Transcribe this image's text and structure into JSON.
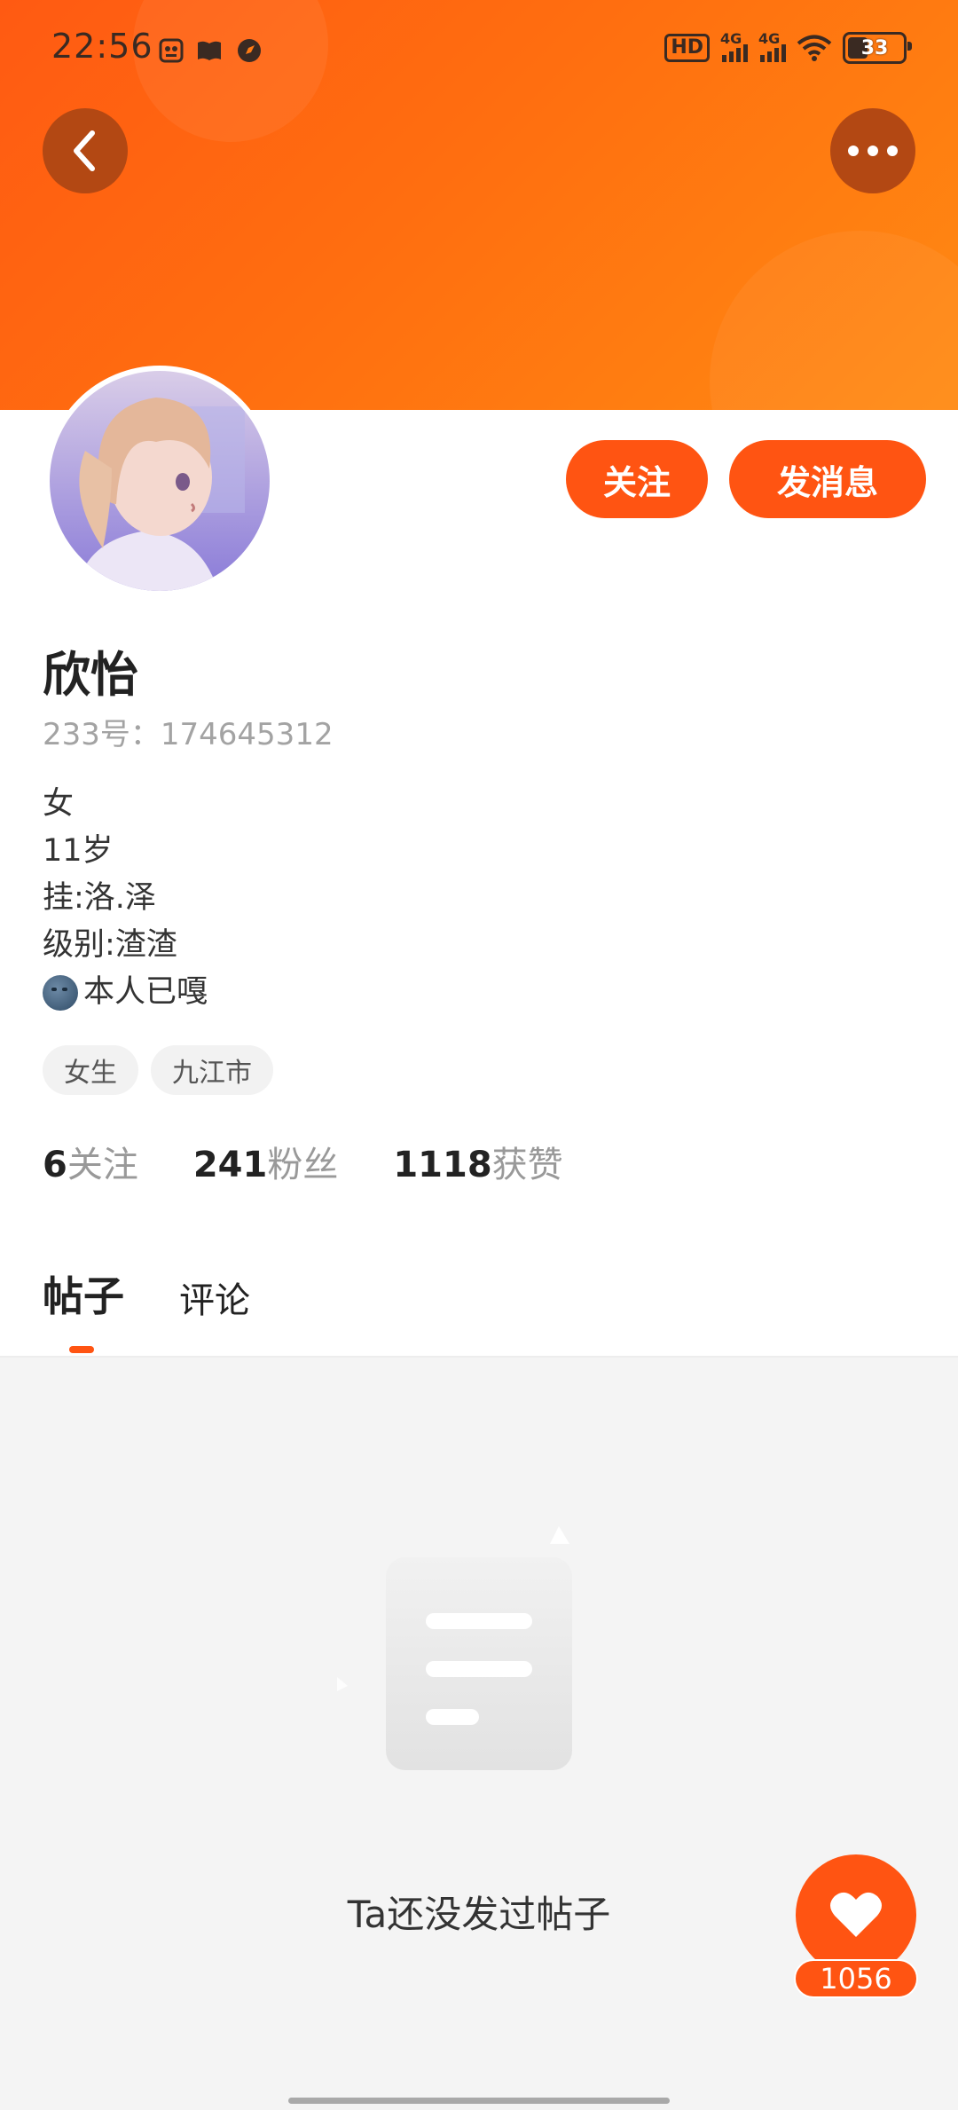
{
  "status_bar": {
    "time": "22:56",
    "hd_label": "HD",
    "network_1": "4G",
    "network_2": "4G",
    "battery": "33"
  },
  "profile": {
    "name": "欣怡",
    "id_line": "233号：174645312",
    "bio": [
      "女",
      "11岁",
      "挂:洛.泽",
      "级别:渣渣",
      "本人已嘎"
    ],
    "tags": [
      "女生",
      "九江市"
    ]
  },
  "actions": {
    "follow_label": "关注",
    "message_label": "发消息"
  },
  "stats": [
    {
      "num": "6",
      "label": "关注"
    },
    {
      "num": "241",
      "label": "粉丝"
    },
    {
      "num": "1118",
      "label": "获赞"
    }
  ],
  "tabs": [
    {
      "label": "帖子",
      "active": true
    },
    {
      "label": "评论",
      "active": false
    }
  ],
  "empty_state": {
    "text": "Ta还没发过帖子"
  },
  "like": {
    "count": "1056"
  },
  "colors": {
    "accent": "#ff5412",
    "banner_start": "#ff5a12",
    "banner_end": "#ff8a12"
  },
  "icons": [
    "back-arrow-icon",
    "more-dots-icon",
    "heart-icon",
    "document-icon",
    "moon-emoji-icon",
    "wifi-icon",
    "battery-icon"
  ]
}
